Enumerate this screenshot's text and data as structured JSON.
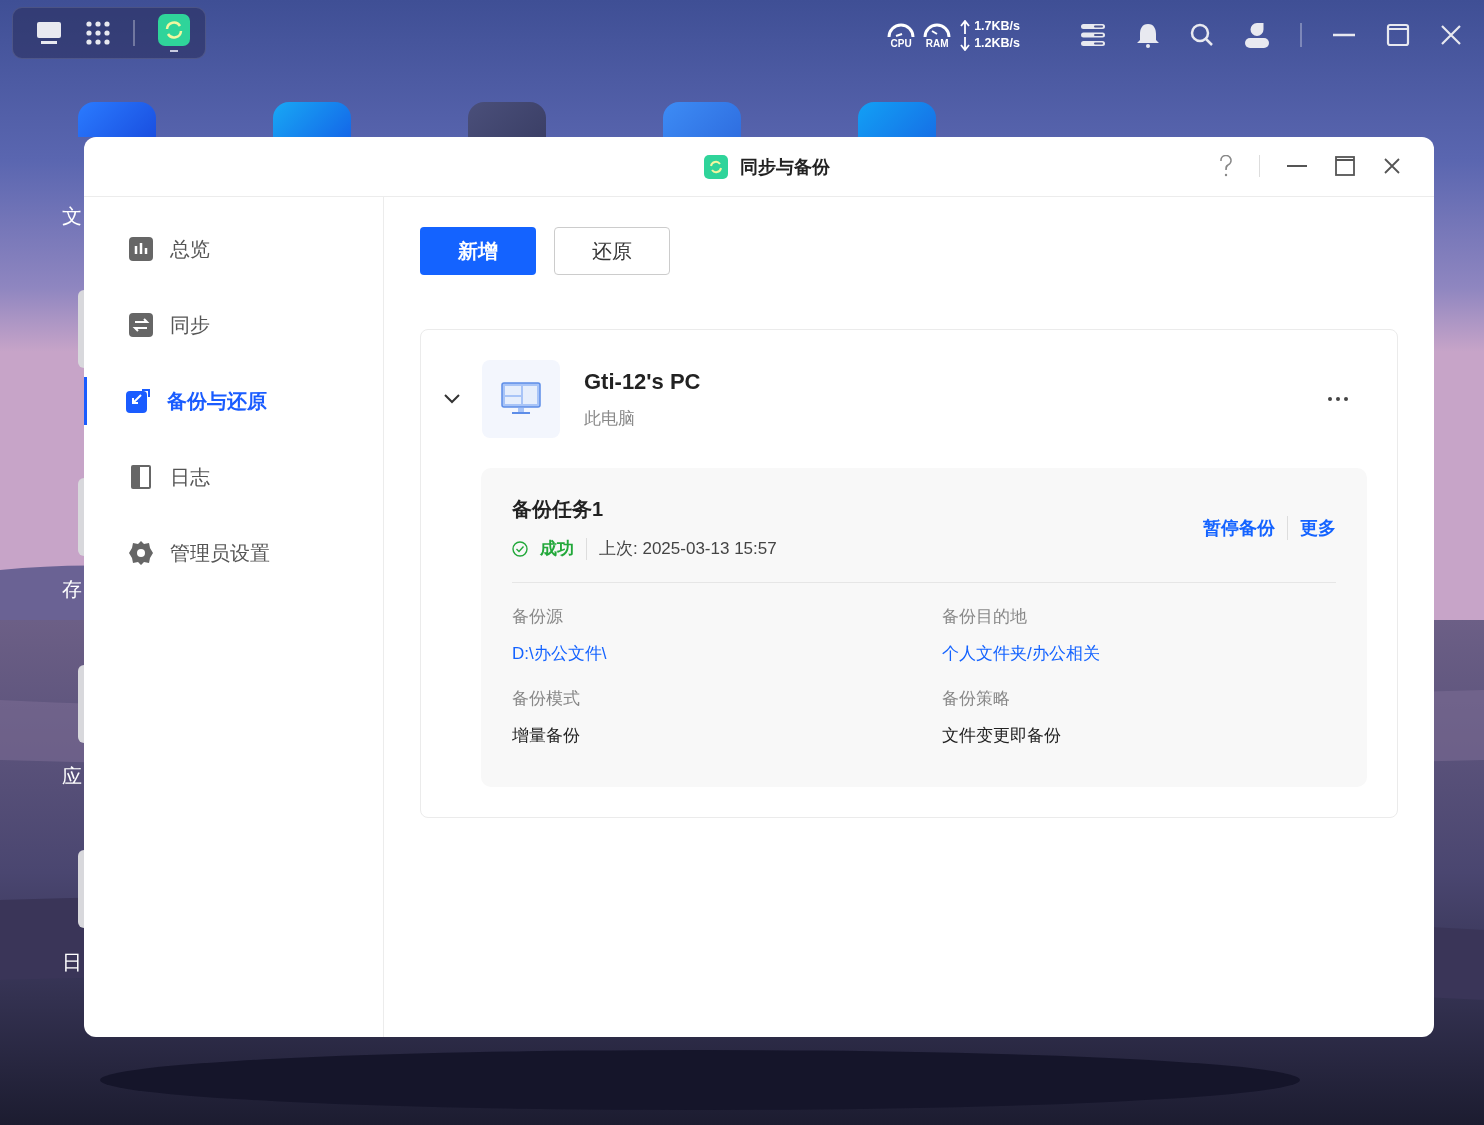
{
  "top_bar": {
    "cpu_label": "CPU",
    "ram_label": "RAM",
    "upload": "1.7KB/s",
    "download": "1.2KB/s"
  },
  "desktop": {
    "side_labels": [
      "文",
      "存",
      "应",
      "日"
    ]
  },
  "window": {
    "title": "同步与备份"
  },
  "sidebar": {
    "items": [
      {
        "label": "总览",
        "kind": "overview",
        "selected": false
      },
      {
        "label": "同步",
        "kind": "sync",
        "selected": false
      },
      {
        "label": "备份与还原",
        "kind": "backup",
        "selected": true
      },
      {
        "label": "日志",
        "kind": "log",
        "selected": false
      },
      {
        "label": "管理员设置",
        "kind": "settings",
        "selected": false
      }
    ]
  },
  "toolbar": {
    "buttons": [
      {
        "label": "新增",
        "kind": "primary"
      },
      {
        "label": "还原",
        "kind": "default"
      }
    ]
  },
  "device": {
    "name": "Gti-12's PC",
    "subtitle": "此电脑",
    "expanded": true,
    "task": {
      "name": "备份任务1",
      "status": "成功",
      "succeeded": true,
      "last_run": "上次: 2025-03-13 15:57",
      "actions": [
        "暂停备份",
        "更多"
      ],
      "fields": [
        {
          "label": "备份源",
          "value": "D:\\办公文件\\",
          "link": true
        },
        {
          "label": "备份目的地",
          "value": "个人文件夹/办公相关",
          "link": true
        },
        {
          "label": "备份模式",
          "value": "增量备份",
          "link": false
        },
        {
          "label": "备份策略",
          "value": "文件变更即备份",
          "link": false
        }
      ]
    }
  }
}
